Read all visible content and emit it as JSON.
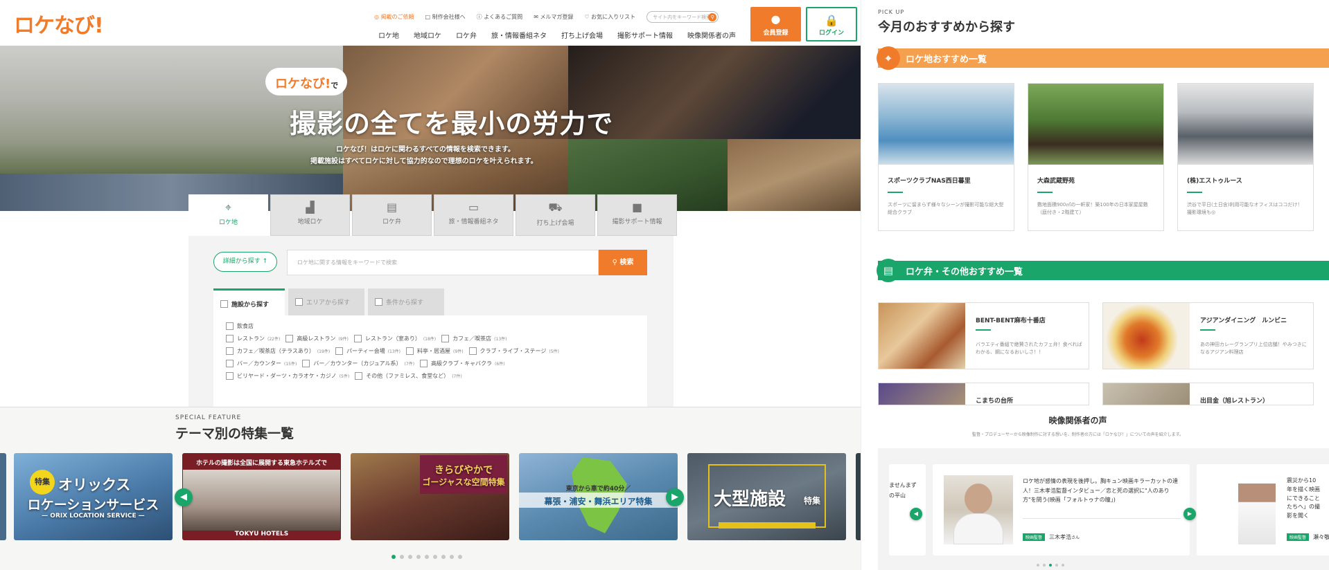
{
  "header": {
    "logo": "ロケなび!",
    "util_links": [
      "掲載のご依頼",
      "制作会社様へ",
      "よくあるご質問",
      "メルマガ登録",
      "お気に入りリスト"
    ],
    "search_placeholder": "サイト内をキーワード検索",
    "nav": [
      "ロケ地",
      "地域ロケ",
      "ロケ弁",
      "旅・情報番組ネタ",
      "打ち上げ会場",
      "撮影サポート情報",
      "映像関係者の声"
    ],
    "register_label": "会員登録",
    "login_label": "ログイン"
  },
  "hero": {
    "bubble_brand": "ロケなび!",
    "bubble_suffix": "で",
    "headline": "撮影の全てを最小の労力で",
    "line1": "ロケなび！はロケに関わるすべての情報を検索できます。",
    "line2": "掲載施設はすべてロケに対して協力的なので理想のロケを叶えられます。"
  },
  "search": {
    "tabs": [
      "ロケ地",
      "地域ロケ",
      "ロケ弁",
      "旅・情報番組ネタ",
      "打ち上げ会場",
      "撮影サポート情報"
    ],
    "detail_button": "詳細から探す",
    "keyword_placeholder": "ロケ地に関する情報をキーワードで検索",
    "search_button": "検索",
    "subtabs": [
      "施設から探す",
      "エリアから探す",
      "条件から探す"
    ],
    "group_label": "飲食店",
    "row1": [
      {
        "label": "レストラン",
        "count": "(22件)"
      },
      {
        "label": "高級レストラン",
        "count": "(9件)"
      },
      {
        "label": "レストラン（室あり）",
        "count": "(18件)"
      },
      {
        "label": "カフェ／喫茶店",
        "count": "(13件)"
      }
    ],
    "row2": [
      {
        "label": "カフェ／喫茶店（テラスあり）",
        "count": "(19件)"
      },
      {
        "label": "パーティー会場",
        "count": "(13件)"
      },
      {
        "label": "料亭・居酒屋",
        "count": "(9件)"
      },
      {
        "label": "クラブ・ライブ・ステージ",
        "count": "(5件)"
      }
    ],
    "row3": [
      {
        "label": "バー／カウンター",
        "count": "(15件)"
      },
      {
        "label": "バー／カウンター（カジュアル系）",
        "count": "(7件)"
      },
      {
        "label": "高級クラブ・キャバクラ",
        "count": "(6件)"
      }
    ],
    "row4": [
      {
        "label": "ビリヤード・ダーツ・カラオケ・カジノ",
        "count": "(5件)"
      },
      {
        "label": "その他（ファミレス、食堂など）",
        "count": "(7件)"
      }
    ]
  },
  "special": {
    "en": "SPECIAL FEATURE",
    "title": "テーマ別の特集一覧",
    "cards": [
      {
        "badge": "特集",
        "title": "オリックス",
        "title2": "ロケーションサービス",
        "sub": "— ORIX LOCATION SERVICE —"
      },
      {
        "title": "ホテルの撮影は全国に展開する東急ホテルズで",
        "sub": "TOKYU HOTELS"
      },
      {
        "title": "きらびやかで",
        "title2": "ゴージャスな空間特集"
      },
      {
        "title": "東京から車で約40分／",
        "title2": "幕張・浦安・舞浜エリア特集"
      },
      {
        "title": "大型施設",
        "title2": "特集"
      }
    ],
    "dots": 9,
    "active_dot": 0
  },
  "pickup": {
    "en": "PICK UP",
    "title": "今月のおすすめから探す",
    "loc_heading": "ロケ地おすすめ一覧",
    "loc_items": [
      {
        "name": "スポーツクラブNAS西日暮里",
        "desc": "スポーツに留まらず様々なシーンが撮影可能な総大型総合クラブ"
      },
      {
        "name": "大森武蔵野苑",
        "desc": "敷地面積900㎡の一軒家！築100年の日本家屋屋敷（庭付き・2階建て）"
      },
      {
        "name": "(株)エストゥルース",
        "desc": "渋谷で平日(土日含)利用可能なオフィスはココだけ！撮影環境も◎"
      }
    ],
    "bento_heading": "ロケ弁・その他おすすめ一覧",
    "bento_items": [
      {
        "name": "BENT-BENT麻布十番店",
        "desc": "バラエティ番組で絶賛されたカフェ弁！食べればわかる、鋼になるおいしさ！！"
      },
      {
        "name": "アジアンダイニング　ルンビニ",
        "desc": "あの神田カレーグランプリ上位店舗！やみつきになるアジアン料理店"
      },
      {
        "name": "こまちの台所",
        "desc": ""
      },
      {
        "name": "出目金（旭レストラン）",
        "desc": ""
      }
    ]
  },
  "voice": {
    "title": "映像関係者の声",
    "sub": "監督・プロデューサーから映像制作に対する想いを、制作者の方には「ロケなび！」についての声を紹介します。",
    "main_text": "ロケ地が感情の表現を後押し。胸キュン映画キラーカットの達人！三木孝浩監督インタビュー／恋と死の選択に\"人のあり方\"を問う(映画「フォルトゥナの瞳」)",
    "main_tag": "映画監督",
    "main_name": "三木孝浩",
    "main_honor": "さん",
    "prev_text1": "ませんまず",
    "prev_text2": "の平山",
    "next_text": "震災から10年を描く映画にできることたちへ」の撮影を聞く",
    "next_tag": "映画監督",
    "next_name": "瀬々敬",
    "dots": 5,
    "active_dot": 2
  },
  "colors": {
    "accent_orange": "#f07c2b",
    "accent_green": "#1aa56a"
  },
  "icons": [
    "pin-icon",
    "building-icon",
    "bento-icon",
    "tv-icon",
    "car-icon",
    "camera-icon",
    "search-icon",
    "user-icon",
    "lock-icon",
    "arrow-left-icon",
    "arrow-right-icon"
  ]
}
